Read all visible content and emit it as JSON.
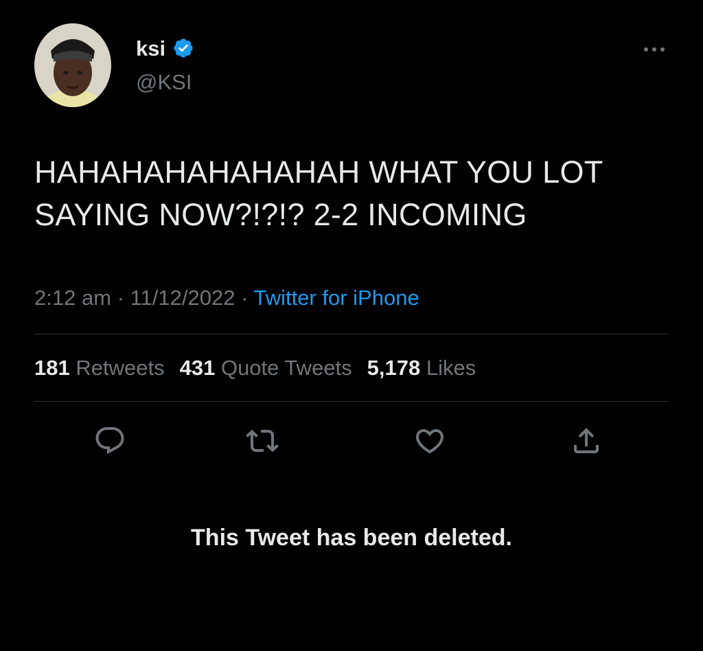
{
  "author": {
    "display_name": "ksi",
    "handle": "@KSI",
    "verified": true,
    "avatar_icon": "profile-photo"
  },
  "tweet": {
    "text": "HAHAHAHAHAHAHAH WHAT YOU LOT SAYING NOW?!?!? 2-2 INCOMING",
    "time": "2:12 am",
    "separator": "·",
    "date": "11/12/2022",
    "source": "Twitter for iPhone"
  },
  "stats": {
    "retweets_count": "181",
    "retweets_label": "Retweets",
    "quotes_count": "431",
    "quotes_label": "Quote Tweets",
    "likes_count": "5,178",
    "likes_label": "Likes"
  },
  "actions": [
    "reply-icon",
    "retweet-icon",
    "like-icon",
    "share-icon"
  ],
  "notice": "This Tweet has been deleted.",
  "colors": {
    "background": "#000000",
    "text": "#e7e9ea",
    "muted": "#71767b",
    "accent": "#1d9bf0",
    "divider": "#2f3336"
  }
}
